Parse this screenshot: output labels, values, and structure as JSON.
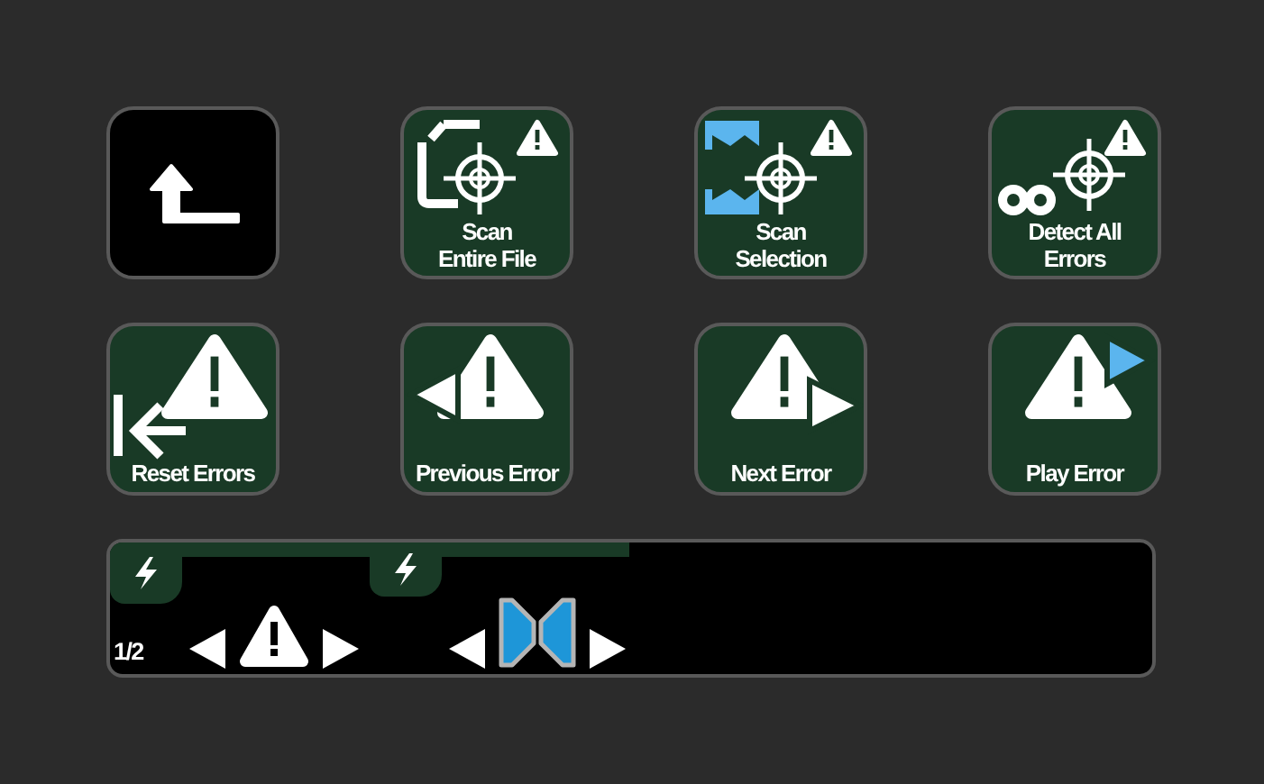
{
  "buttons": [
    {
      "kind": "back",
      "warning_badge": false
    },
    {
      "kind": "scan_file",
      "labels": [
        "Scan",
        "Entire File"
      ],
      "warning_badge": true
    },
    {
      "kind": "scan_selection",
      "labels": [
        "Scan",
        "Selection"
      ],
      "warning_badge": true
    },
    {
      "kind": "detect_all",
      "labels": [
        "Detect All",
        "Errors"
      ],
      "warning_badge": true
    },
    {
      "kind": "reset",
      "labels": [
        "Reset Errors"
      ],
      "warning_badge": false
    },
    {
      "kind": "previous",
      "labels": [
        "Previous Error"
      ],
      "warning_badge": false
    },
    {
      "kind": "next",
      "labels": [
        "Next Error"
      ],
      "warning_badge": false
    },
    {
      "kind": "play",
      "labels": [
        "Play Error"
      ],
      "warning_badge": false
    }
  ],
  "dial_bar": {
    "page": "1/2",
    "dials": [
      {
        "kind": "warning"
      },
      {
        "kind": "bowtie"
      }
    ]
  }
}
